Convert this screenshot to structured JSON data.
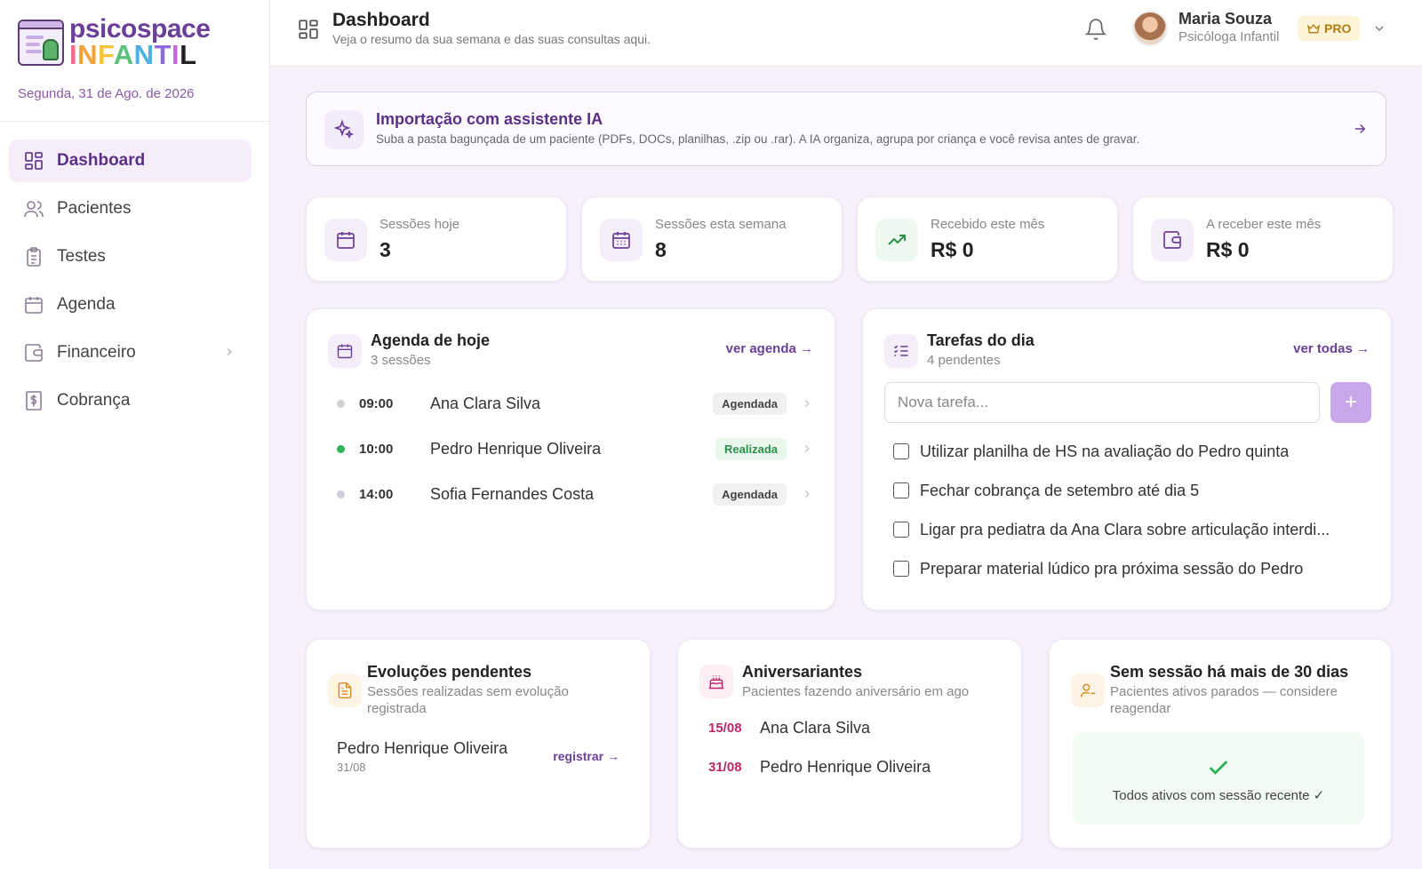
{
  "brand": {
    "name_top": "psicospace",
    "name_bottom": "INFANTIL",
    "date": "Segunda, 31 de Ago. de 2026"
  },
  "nav": [
    {
      "label": "Dashboard",
      "icon": "dashboard-icon",
      "active": true
    },
    {
      "label": "Pacientes",
      "icon": "users-icon"
    },
    {
      "label": "Testes",
      "icon": "clipboard-icon"
    },
    {
      "label": "Agenda",
      "icon": "calendar-icon"
    },
    {
      "label": "Financeiro",
      "icon": "wallet-icon",
      "has_submenu": true
    },
    {
      "label": "Cobrança",
      "icon": "dollar-doc-icon"
    }
  ],
  "header": {
    "title": "Dashboard",
    "subtitle": "Veja o resumo da sua semana e das suas consultas aqui.",
    "user_name": "Maria Souza",
    "user_role": "Psicóloga Infantil",
    "plan_badge": "PRO"
  },
  "ai_banner": {
    "title": "Importação com assistente IA",
    "subtitle": "Suba a pasta bagunçada de um paciente (PDFs, DOCs, planilhas, .zip ou .rar). A IA organiza, agrupa por criança e você revisa antes de gravar."
  },
  "stats": [
    {
      "label": "Sessões hoje",
      "value": "3",
      "icon": "calendar-icon",
      "color": "#6a3f97",
      "bg": "#f4eefa"
    },
    {
      "label": "Sessões esta semana",
      "value": "8",
      "icon": "calendar-grid-icon",
      "color": "#6a3f97",
      "bg": "#f4eefa"
    },
    {
      "label": "Recebido este mês",
      "value": "R$ 0",
      "icon": "trending-up-icon",
      "color": "#2c8f4a",
      "bg": "#edf8f0"
    },
    {
      "label": "A receber este mês",
      "value": "R$ 0",
      "icon": "wallet-icon",
      "color": "#6a3f97",
      "bg": "#f4eefa"
    }
  ],
  "agenda": {
    "title": "Agenda de hoje",
    "subtitle": "3 sessões",
    "link": "ver agenda →",
    "items": [
      {
        "time": "09:00",
        "name": "Ana Clara Silva",
        "status": "Agendada",
        "done": false
      },
      {
        "time": "10:00",
        "name": "Pedro Henrique Oliveira",
        "status": "Realizada",
        "done": true
      },
      {
        "time": "14:00",
        "name": "Sofia Fernandes Costa",
        "status": "Agendada",
        "done": false
      }
    ]
  },
  "tasks": {
    "title": "Tarefas do dia",
    "subtitle": "4 pendentes",
    "link": "ver todas →",
    "placeholder": "Nova tarefa...",
    "add_label": "+",
    "items": [
      "Utilizar planilha de HS na avaliação do Pedro quinta",
      "Fechar cobrança de setembro até dia 5",
      "Ligar pra pediatra da Ana Clara sobre articulação interdi...",
      "Preparar material lúdico pra próxima sessão do Pedro"
    ]
  },
  "pending": {
    "title": "Evoluções pendentes",
    "subtitle": "Sessões realizadas sem evolução registrada",
    "item_name": "Pedro Henrique Oliveira",
    "item_date": "31/08",
    "link": "registrar →"
  },
  "birthdays": {
    "title": "Aniversariantes",
    "subtitle": "Pacientes fazendo aniversário em ago",
    "items": [
      {
        "date": "15/08",
        "name": "Ana Clara Silva"
      },
      {
        "date": "31/08",
        "name": "Pedro Henrique Oliveira"
      }
    ]
  },
  "inactive": {
    "title": "Sem sessão há mais de 30 dias",
    "subtitle": "Pacientes ativos parados — considere reagendar",
    "empty_text": "Todos ativos com sessão recente ✓"
  }
}
